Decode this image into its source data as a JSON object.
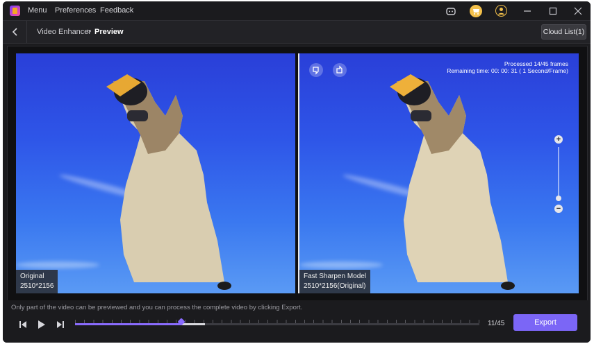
{
  "titlebar": {
    "menu_items": [
      "Menu",
      "Preferences",
      "Feedback"
    ]
  },
  "navbar": {
    "breadcrumb_parent": "Video Enhancer",
    "breadcrumb_separator": ">",
    "breadcrumb_current": "Preview",
    "cloud_list_label": "Cloud List(1)"
  },
  "preview": {
    "left": {
      "label": "Original",
      "resolution": "2510*2156"
    },
    "right": {
      "label": "Fast Sharpen Model",
      "resolution": "2510*2156(Original)",
      "processed": "Processed 14/45 frames",
      "remaining": "Remaining time: 00: 00: 31 ( 1 Second/Frame)"
    },
    "zoom_in": "+",
    "zoom_out": "−"
  },
  "footer": {
    "hint": "Only part of the video can be previewed and you can process the complete video by clicking Export.",
    "frame_counter": "11/45",
    "export_label": "Export",
    "progress": {
      "processed_frames": 14,
      "current_frame": 11,
      "total_frames": 45
    }
  },
  "colors": {
    "accent": "#7b66f6",
    "background": "#1b1b1e"
  }
}
